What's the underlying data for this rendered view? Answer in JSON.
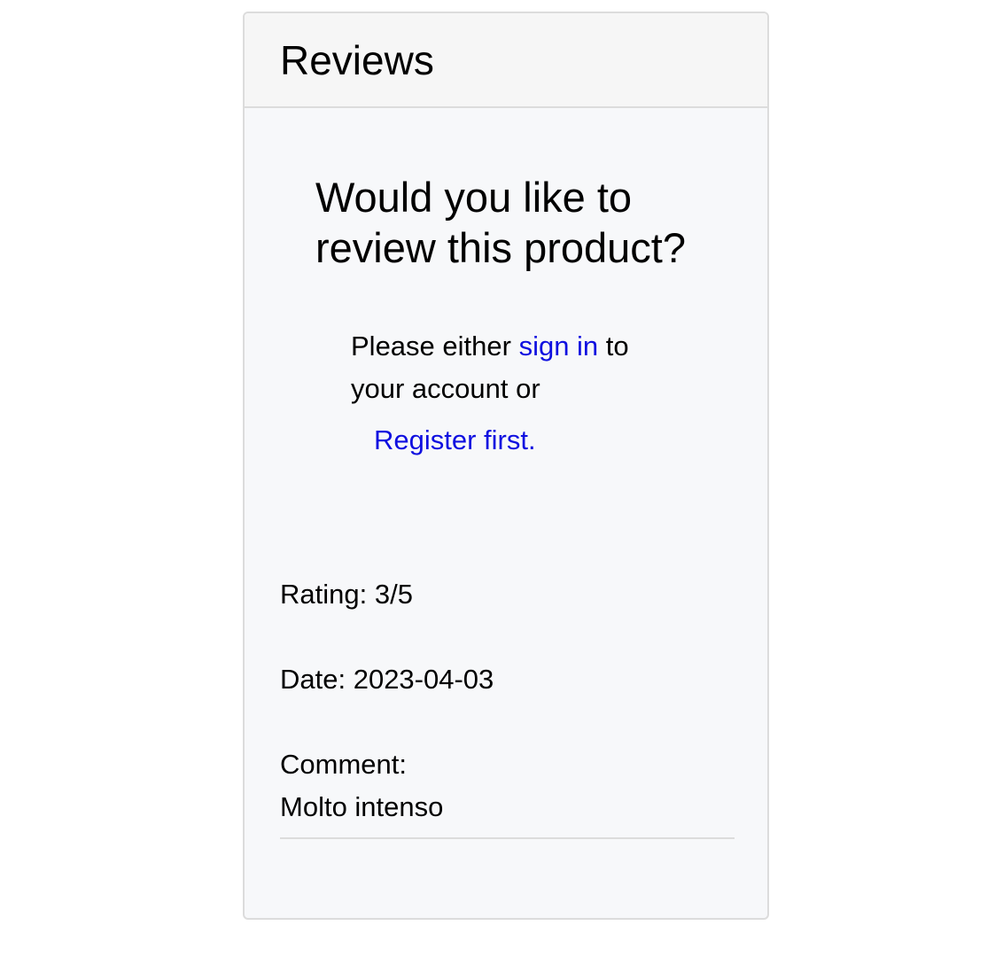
{
  "reviews": {
    "title": "Reviews",
    "prompt": {
      "heading": "Would you like to review this product?",
      "text_before": "Please either ",
      "sign_in_label": "sign in",
      "text_after": " to your account or",
      "register_label": "Register first."
    },
    "items": [
      {
        "rating_label": "Rating: 3/5",
        "date_label": "Date: 2023-04-03",
        "comment_label": "Comment:",
        "comment_text": "Molto intenso"
      }
    ]
  },
  "colors": {
    "link": "#0f0fe0",
    "card_background": "#f7f8fa",
    "header_background": "#f6f6f6",
    "border": "#dcdcdc"
  }
}
